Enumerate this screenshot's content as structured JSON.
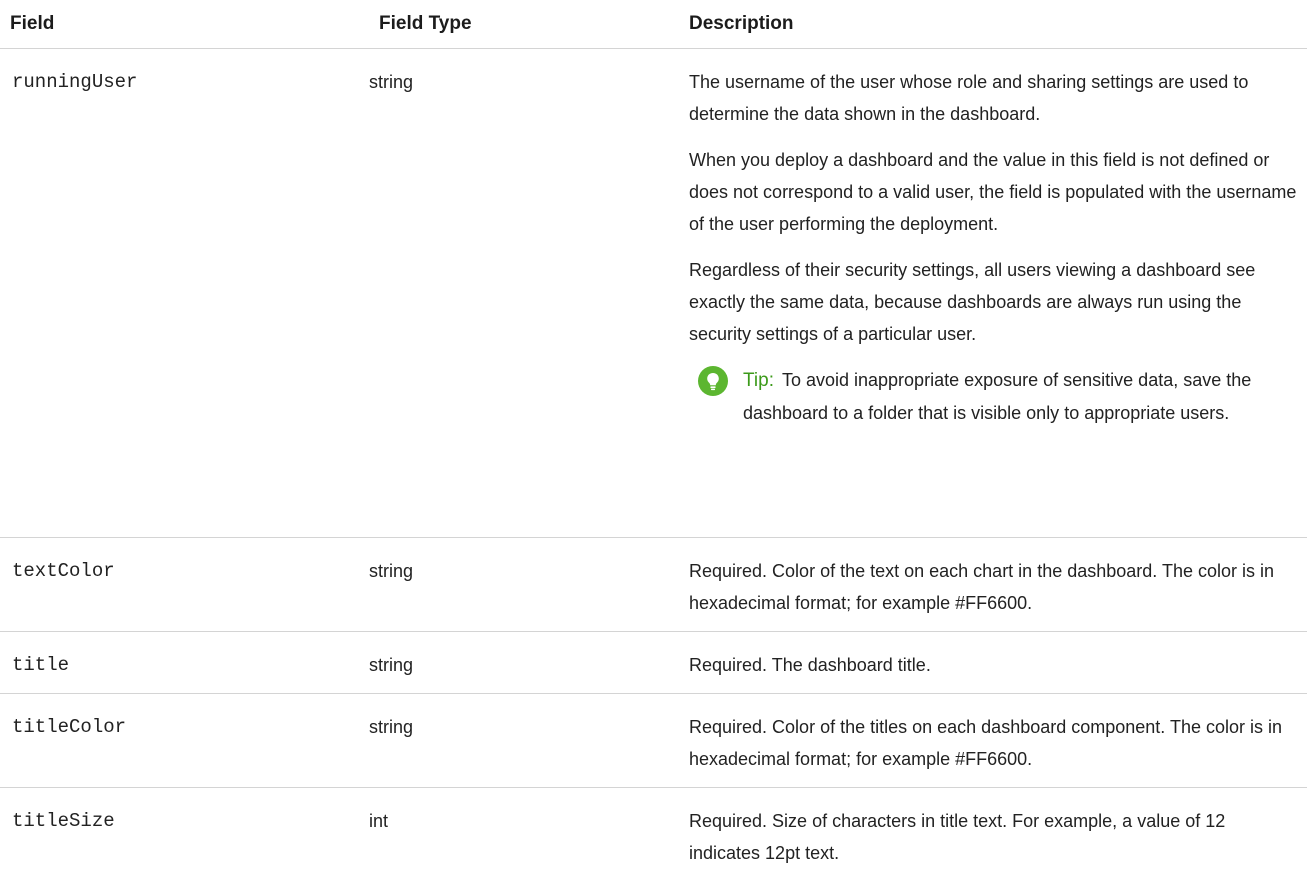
{
  "table": {
    "headers": {
      "field": "Field",
      "field_type": "Field Type",
      "description": "Description"
    },
    "rows": [
      {
        "field": "runningUser",
        "field_type": "string",
        "description": [
          "The username of the user whose role and sharing settings are used to determine the data shown in the dashboard.",
          "When you deploy a dashboard and the value in this field is not defined or does not correspond to a valid user, the field is populated with the username of the user performing the deployment.",
          "Regardless of their security settings, all users viewing a dashboard see exactly the same data, because dashboards are always run using the security settings of a particular user."
        ],
        "tip": {
          "label": "Tip:",
          "text": "To avoid inappropriate exposure of sensitive data, save the dashboard to a folder that is visible only to appropriate users.",
          "icon": "lightbulb-icon"
        }
      },
      {
        "field": "textColor",
        "field_type": "string",
        "description": [
          "Required. Color of the text on each chart in the dashboard. The color is in hexadecimal format; for example #FF6600."
        ]
      },
      {
        "field": "title",
        "field_type": "string",
        "description": [
          "Required. The dashboard title."
        ]
      },
      {
        "field": "titleColor",
        "field_type": "string",
        "description": [
          "Required. Color of the titles on each dashboard component. The color is in hexadecimal format; for example #FF6600."
        ]
      },
      {
        "field": "titleSize",
        "field_type": "int",
        "description": [
          "Required. Size of characters in title text. For example, a value of 12 indicates 12pt text."
        ]
      }
    ]
  },
  "colors": {
    "tip_green": "#3c9a1a",
    "tip_icon_green": "#5cb630",
    "rule": "#d4d4d4"
  }
}
